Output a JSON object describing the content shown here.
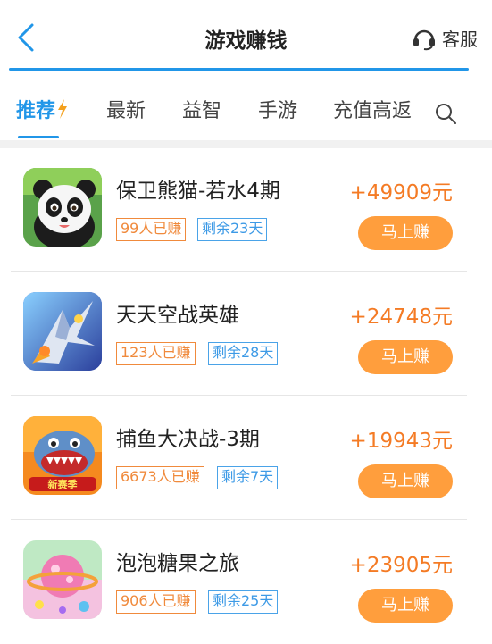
{
  "header": {
    "title": "游戏赚钱",
    "service_label": "客服"
  },
  "tabs": [
    {
      "label": "推荐",
      "active": true
    },
    {
      "label": "最新"
    },
    {
      "label": "益智"
    },
    {
      "label": "手游"
    },
    {
      "label": "充值高返"
    }
  ],
  "colors": {
    "accent": "#2196e8",
    "reward": "#f47b25",
    "button": "#ff9e3d",
    "earned_border": "#f08a3c",
    "remaining_border": "#4aa3e8"
  },
  "games": [
    {
      "name": "保卫熊猫-若水4期",
      "earned": "99人已赚",
      "remaining": "剩余23天",
      "reward": "+49909元",
      "button": "马上赚",
      "icon": "panda-game-icon"
    },
    {
      "name": "天天空战英雄",
      "earned": "123人已赚",
      "remaining": "剩余28天",
      "reward": "+24748元",
      "button": "马上赚",
      "icon": "jet-fighter-game-icon"
    },
    {
      "name": "捕鱼大决战-3期",
      "earned": "6673人已赚",
      "remaining": "剩余7天",
      "reward": "+19943元",
      "button": "马上赚",
      "icon": "shark-fishing-game-icon",
      "icon_badge": "新赛季"
    },
    {
      "name": "泡泡糖果之旅",
      "earned": "906人已赚",
      "remaining": "剩余25天",
      "reward": "+23905元",
      "button": "马上赚",
      "icon": "candy-planet-game-icon"
    }
  ]
}
